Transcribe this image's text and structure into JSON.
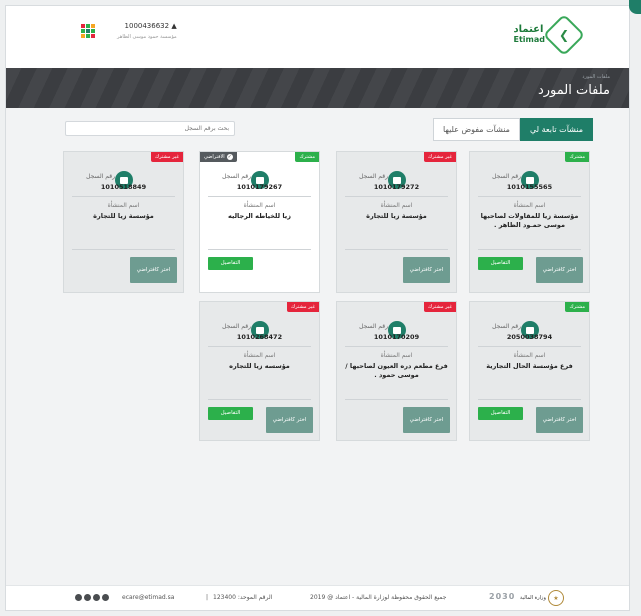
{
  "header": {
    "logo_ar": "اعتماد",
    "logo_en": "Etimad",
    "user_id": "1000436632",
    "user_org": "مؤسسة حمود موسى الظاهر"
  },
  "banner": {
    "breadcrumb": "ملفات المورد",
    "title": "ملفات المورد"
  },
  "tabs": [
    {
      "label": "منشآت تابعة لي",
      "active": true
    },
    {
      "label": "منشآت مفوض عليها",
      "active": false
    }
  ],
  "search": {
    "placeholder": "بحث برقم السجل"
  },
  "labels": {
    "reg_label": "رقم السجل",
    "name_label": "اسم المنشأة",
    "btn_default": "اختر كافتراضي",
    "btn_details": "التفاصيل"
  },
  "cards": [
    {
      "badge": "مشترك",
      "badge_color": "green",
      "reg": "1010155565",
      "name": "مؤسسة زيا للمقاولات لصاحبها موسى حمـود الظاهر .",
      "show_details": true
    },
    {
      "badge": "غير مشترك",
      "badge_color": "red",
      "reg": "1010179272",
      "name": "مؤسسة زيا للتجارة",
      "show_details": false
    },
    {
      "badge": "مشترك",
      "badge_color": "green",
      "badge2": "الافتراضي",
      "reg": "1010179267",
      "name": "زيا للخياطه الرجاليه",
      "show_details": true,
      "is_default": true
    },
    {
      "badge": "غير مشترك",
      "badge_color": "red",
      "reg": "1010518849",
      "name": "مؤسسة زيا للتجارة",
      "show_details": false
    },
    {
      "badge": "مشترك",
      "badge_color": "green",
      "reg": "2050038794",
      "name": "فرع مؤسسة الحال التجارية",
      "show_details": true
    },
    {
      "badge": "غير مشترك",
      "badge_color": "red",
      "reg": "1010170209",
      "name": "فرع مطعم دره العيون لصاحبها / موسى حمود .",
      "show_details": false
    },
    {
      "badge": "غير مشترك",
      "badge_color": "red",
      "reg": "1010268472",
      "name": "مؤسسه زيا للتجاره",
      "show_details": true
    }
  ],
  "footer": {
    "email": "ecare@etimad.sa",
    "separator": "|",
    "phone": "الرقم الموحد: 123400",
    "copyright": "جميع الحقوق محفوظة لوزارة المالية - اعتماد @ 2019",
    "vision": "2030",
    "mof": "وزارة المالية"
  },
  "colors": {
    "primary": "#1f7e68",
    "green": "#2cb04b",
    "red": "#e5253c",
    "banner": "#3e4044"
  }
}
